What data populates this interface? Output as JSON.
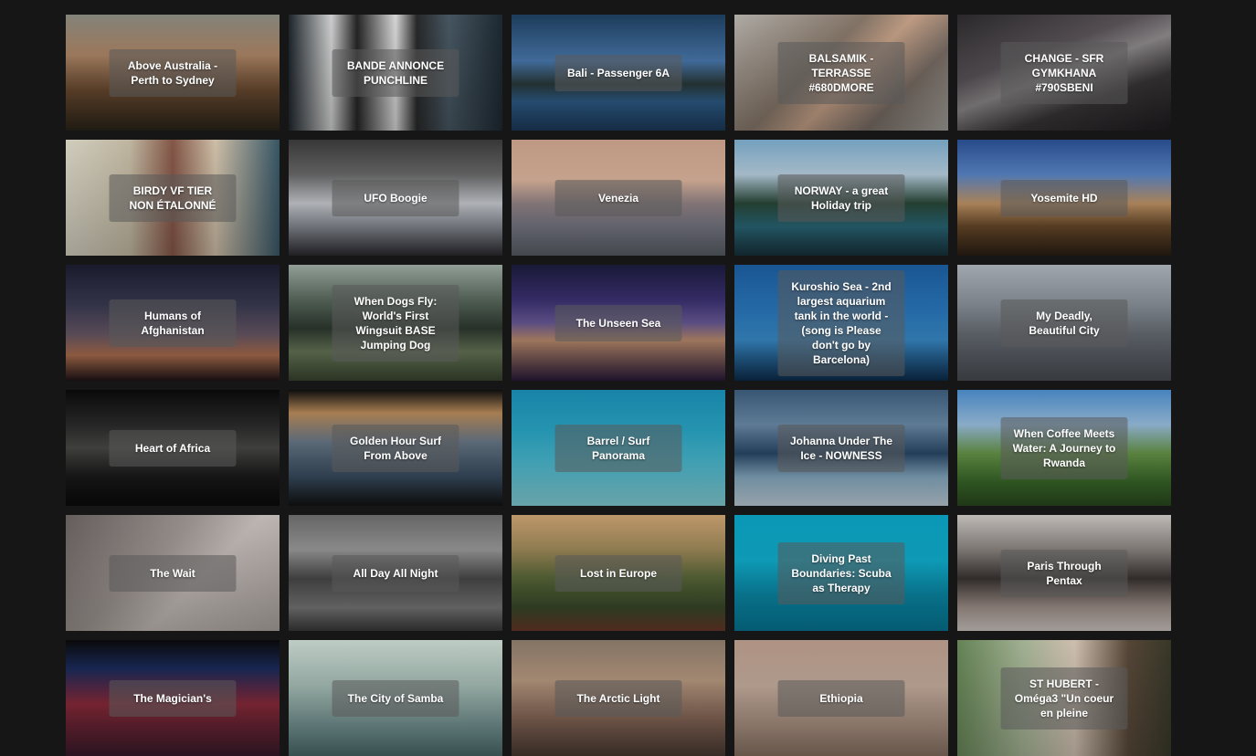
{
  "videos": [
    {
      "title": "Above Australia - Perth to Sydney",
      "bg": "linear-gradient(180deg,#8a8a80 0%,#b08868 35%,#6a4a30 65%,#2a2418 100%)"
    },
    {
      "title": "BANDE ANNONCE PUNCHLINE",
      "bg": "linear-gradient(90deg,#20282e 0%,#d8d8d8 20%,#262626 32%,#e0e0e0 50%,#2a2a2a 60%,#4a5a66 75%,#1e2a33 100%)"
    },
    {
      "title": "Bali - Passenger 6A",
      "bg": "linear-gradient(180deg,#1e3e5e 0%,#4a7ab0 40%,#2a3a3a 60%,#2e5e8a 75%,#1c3a5c 100%)"
    },
    {
      "title": "BALSAMIK - TERRASSE #680DMORE",
      "bg": "linear-gradient(135deg,#b8b4ae 0%,#8a7a6c 40%,#c9a48a 55%,#7a6e66 75%,#a8a49e 100%)"
    },
    {
      "title": "CHANGE - SFR GYMKHANA #790SBENI",
      "bg": "linear-gradient(160deg,#2c2a2c 0%,#5a5458 35%,#8e8a8c 50%,#3a3638 70%,#1e1c1e 100%)"
    },
    {
      "title": "BIRDY VF TIER NON ÉTALONNÉ",
      "bg": "linear-gradient(90deg,#dcd8c8 0%,#c9bfa8 30%,#8a5a4a 50%,#d8c8b0 70%,#3a5a6a 100%)"
    },
    {
      "title": "UFO Boogie",
      "bg": "linear-gradient(180deg,#3a3a3a 0%,#6a6a6a 30%,#cfd2d8 55%,#8a8e96 75%,#2a2a2e 100%)"
    },
    {
      "title": "Venezia",
      "bg": "linear-gradient(180deg,#c8a08a 0%,#e0b8a0 35%,#9a8a8c 55%,#7a7a88 75%,#5a6068 100%)"
    },
    {
      "title": "NORWAY - a great Holiday trip",
      "bg": "linear-gradient(180deg,#7aa8c8 0%,#b8d0e0 30%,#2a4a3a 55%,#2a6a7a 75%,#18323c 100%)"
    },
    {
      "title": "Yosemite HD",
      "bg": "linear-gradient(180deg,#2a4e90 0%,#5a86c8 30%,#c89a6a 55%,#6a4a2a 75%,#2a1e14 100%)"
    },
    {
      "title": "Humans of Afghanistan",
      "bg": "linear-gradient(180deg,#1a1c2e 0%,#3a3a52 35%,#6a5a68 60%,#b07050 78%,#201418 100%)"
    },
    {
      "title": "When Dogs Fly: World's First Wingsuit BASE Jumping Dog",
      "bg": "linear-gradient(180deg,#9aa8a0 0%,#5a6a5e 30%,#2e3a30 55%,#6a7a5a 75%,#3a4630 100%)"
    },
    {
      "title": "The Unseen Sea",
      "bg": "linear-gradient(180deg,#1a1a3a 0%,#3a3070 30%,#6a5a9a 50%,#c09070 65%,#2a1a3a 100%)"
    },
    {
      "title": "Kuroshio Sea - 2nd largest aquarium tank in the world - (song is Please don't go by Barcelona)",
      "bg": "linear-gradient(180deg,#1a5a9a 0%,#2a7ac0 40%,#3a90d0 65%,#0c2c4c 100%)"
    },
    {
      "title": "My Deadly, Beautiful City",
      "bg": "linear-gradient(180deg,#aab0b8 0%,#8a929a 35%,#6a7078 60%,#4a4e54 100%)"
    },
    {
      "title": "Heart of Africa",
      "bg": "linear-gradient(180deg,#0a0a0a 0%,#2a2a2a 30%,#4a4a48 50%,#1a1a1a 75%,#0a0a0a 100%)"
    },
    {
      "title": "Golden Hour Surf From Above",
      "bg": "linear-gradient(180deg,#0e0e0e 0%,#b88a5a 20%,#6a7a8a 45%,#3a4e62 75%,#121212 100%)"
    },
    {
      "title": "Barrel / Surf Panorama",
      "bg": "linear-gradient(180deg,#1a8ab0 0%,#2aa8c8 35%,#4ac0d8 60%,#8ad8e0 100%)"
    },
    {
      "title": "Johanna Under The Ice - NOWNESS",
      "bg": "linear-gradient(180deg,#3a5a78 0%,#6a8aa8 30%,#2a4a6a 55%,#8ab0c8 75%,#c8d8e4 100%)"
    },
    {
      "title": "When Coffee Meets Water: A Journey to Rwanda",
      "bg": "linear-gradient(180deg,#4a8ac8 0%,#9ac0e0 30%,#6a9a4a 55%,#3a6a2a 80%,#2a4a1e 100%)"
    },
    {
      "title": "The Wait",
      "bg": "linear-gradient(135deg,#6a6260 0%,#a09894 40%,#c8c0bc 60%,#b0a8a4 100%)"
    },
    {
      "title": "All Day All Night",
      "bg": "linear-gradient(180deg,#6a6a6a 0%,#9a9a9a 30%,#4a4a4a 55%,#7a7a7a 80%,#3a3a3a 100%)"
    },
    {
      "title": "Lost in Europe",
      "bg": "linear-gradient(180deg,#c8a070 0%,#a08a5a 30%,#5a6a3a 55%,#3a4a2a 80%,#6a3a2a 100%)"
    },
    {
      "title": "Diving Past Boundaries: Scuba as Therapy",
      "bg": "linear-gradient(180deg,#0aa0c0 0%,#10b0d0 40%,#0a8aa8 70%,#067a98 100%)"
    },
    {
      "title": "Paris Through Pentax",
      "bg": "linear-gradient(180deg,#c8c4c0 0%,#8a8480 30%,#3a3432 55%,#a89890 80%,#d8d0cc 100%)"
    },
    {
      "title": "The Magician's",
      "bg": "linear-gradient(180deg,#0a0a0a 0%,#1a2a5a 25%,#8a2a3a 55%,#3a1a2a 100%)"
    },
    {
      "title": "The City of Samba",
      "bg": "linear-gradient(180deg,#c8d8d0 0%,#a8c0b8 40%,#6a8a8a 80%,#4a6a6a 100%)"
    },
    {
      "title": "The Arctic Light",
      "bg": "linear-gradient(180deg,#8a7a6a 0%,#b89a80 35%,#8a6a5a 65%,#4a3a32 100%)"
    },
    {
      "title": "Ethiopia",
      "bg": "linear-gradient(180deg,#b89a8a 0%,#c8b0a0 40%,#a89080 75%,#8a7264 100%)"
    },
    {
      "title": "ST HUBERT - Oméga3 \"Un coeur en pleine",
      "bg": "linear-gradient(90deg,#6a8a5a 0%,#a8b898 30%,#d8c8b8 55%,#5a4a3a 80%,#3a3a2a 100%)"
    }
  ]
}
